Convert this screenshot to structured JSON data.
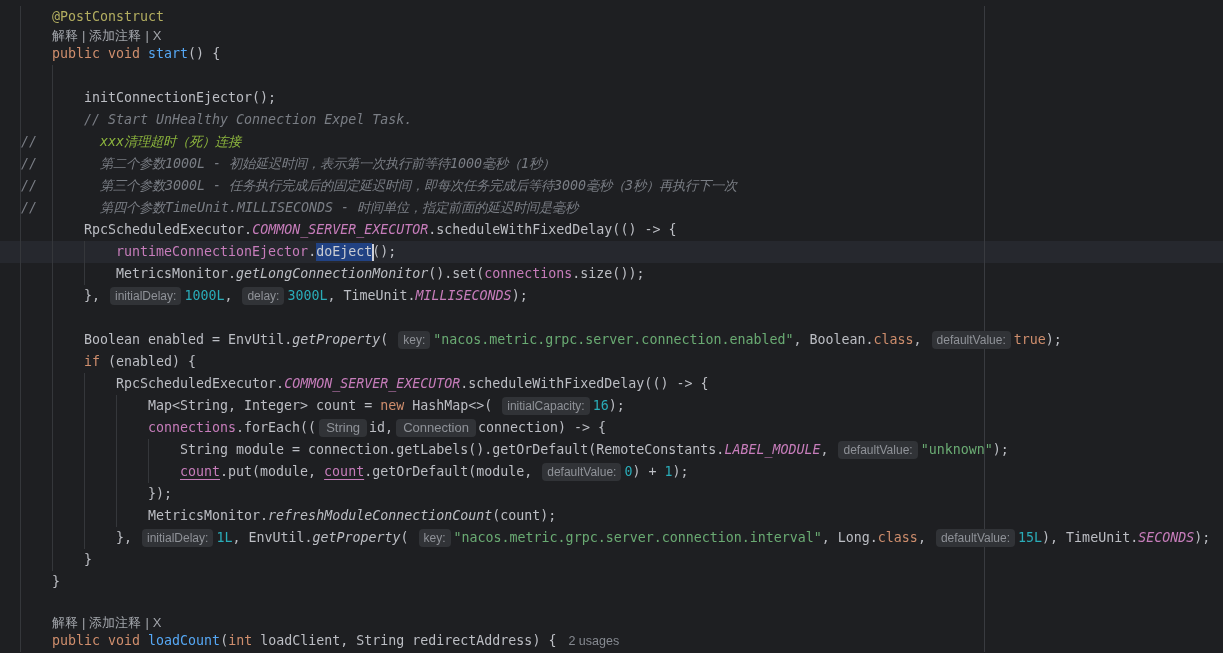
{
  "editor": {
    "lines": [
      {
        "kind": "code",
        "current": false,
        "segments": [
          {
            "kind": "code",
            "runs": [
              {
                "kind": "annotation",
                "text": "@PostConstruct"
              }
            ]
          }
        ]
      },
      {
        "kind": "code_vision",
        "current": false,
        "items": [
          {
            "kind": "action",
            "text": "解释"
          },
          {
            "kind": "separator",
            "text": "|"
          },
          {
            "kind": "action",
            "text": "添加注释"
          },
          {
            "kind": "separator",
            "text": "|"
          },
          {
            "kind": "action",
            "text": "X"
          }
        ]
      },
      {
        "kind": "code",
        "current": false,
        "segments": [
          {
            "kind": "code",
            "runs": [
              {
                "kind": "keyword",
                "text": "public void "
              },
              {
                "kind": "method_decl",
                "text": "start"
              },
              {
                "kind": "plain",
                "text": "() {"
              }
            ]
          }
        ],
        "children": [
          {
            "kind": "blank",
            "current": false
          },
          {
            "kind": "code",
            "current": false,
            "segments": [
              {
                "kind": "code",
                "runs": [
                  {
                    "kind": "plain",
                    "text": "initConnectionEjector();"
                  }
                ]
              }
            ]
          },
          {
            "kind": "code",
            "current": false,
            "segments": [
              {
                "kind": "code",
                "runs": [
                  {
                    "kind": "comment",
                    "text": "// Start UnHealthy Connection Expel Task."
                  }
                ]
              }
            ]
          },
          {
            "kind": "commented",
            "current": false,
            "marker": "//",
            "segments": [
              {
                "kind": "code",
                "runs": [
                  {
                    "kind": "todo",
                    "text": "xxx清理超时（死）连接"
                  }
                ]
              }
            ]
          },
          {
            "kind": "commented",
            "current": false,
            "marker": "//",
            "segments": [
              {
                "kind": "code",
                "runs": [
                  {
                    "kind": "comment",
                    "text": "第二个参数1000L - 初始延迟时间，表示第一次执行前等待1000毫秒（1秒）"
                  }
                ]
              }
            ]
          },
          {
            "kind": "commented",
            "current": false,
            "marker": "//",
            "segments": [
              {
                "kind": "code",
                "runs": [
                  {
                    "kind": "comment",
                    "text": "第三个参数3000L - 任务执行完成后的固定延迟时间，即每次任务完成后等待3000毫秒（3秒）再执行下一次"
                  }
                ]
              }
            ]
          },
          {
            "kind": "commented",
            "current": false,
            "marker": "//",
            "segments": [
              {
                "kind": "code",
                "runs": [
                  {
                    "kind": "comment",
                    "text": "第四个参数TimeUnit.MILLISECONDS - 时间单位，指定前面的延迟时间是毫秒"
                  }
                ]
              }
            ]
          },
          {
            "kind": "code",
            "current": false,
            "segments": [
              {
                "kind": "code",
                "runs": [
                  {
                    "kind": "plain",
                    "text": "RpcScheduledExecutor."
                  },
                  {
                    "kind": "static_field",
                    "text": "COMMON_SERVER_EXECUTOR"
                  },
                  {
                    "kind": "plain",
                    "text": ".scheduleWithFixedDelay(() -> {"
                  }
                ]
              }
            ],
            "children": [
              {
                "kind": "code",
                "current": true,
                "segments": [
                  {
                    "kind": "code",
                    "runs": [
                      {
                        "kind": "field",
                        "text": "runtimeConnectionEjector"
                      },
                      {
                        "kind": "plain",
                        "text": "."
                      }
                    ]
                  },
                  {
                    "kind": "selection",
                    "text": "doEject",
                    "caret": true
                  },
                  {
                    "kind": "code",
                    "runs": [
                      {
                        "kind": "plain",
                        "text": "();"
                      }
                    ]
                  }
                ]
              },
              {
                "kind": "code",
                "current": false,
                "segments": [
                  {
                    "kind": "code",
                    "runs": [
                      {
                        "kind": "plain",
                        "text": "MetricsMonitor."
                      },
                      {
                        "kind": "static_call",
                        "text": "getLongConnectionMonitor"
                      },
                      {
                        "kind": "plain",
                        "text": "().set("
                      },
                      {
                        "kind": "field",
                        "text": "connections"
                      },
                      {
                        "kind": "plain",
                        "text": ".size());"
                      }
                    ]
                  }
                ]
              }
            ]
          },
          {
            "kind": "code",
            "current": false,
            "segments": [
              {
                "kind": "code",
                "runs": [
                  {
                    "kind": "plain",
                    "text": "},"
                  }
                ]
              },
              {
                "kind": "param_hint",
                "text": "initialDelay:"
              },
              {
                "kind": "code",
                "runs": [
                  {
                    "kind": "number",
                    "text": "1000L"
                  },
                  {
                    "kind": "plain",
                    "text": ","
                  }
                ]
              },
              {
                "kind": "param_hint",
                "text": "delay:"
              },
              {
                "kind": "code",
                "runs": [
                  {
                    "kind": "number",
                    "text": "3000L"
                  },
                  {
                    "kind": "plain",
                    "text": ", TimeUnit."
                  },
                  {
                    "kind": "static_field",
                    "text": "MILLISECONDS"
                  },
                  {
                    "kind": "plain",
                    "text": ");"
                  }
                ]
              }
            ]
          },
          {
            "kind": "blank",
            "current": false
          },
          {
            "kind": "code",
            "current": false,
            "segments": [
              {
                "kind": "code",
                "runs": [
                  {
                    "kind": "plain",
                    "text": "Boolean enabled = EnvUtil."
                  },
                  {
                    "kind": "static_call",
                    "text": "getProperty"
                  },
                  {
                    "kind": "plain",
                    "text": "("
                  }
                ]
              },
              {
                "kind": "param_hint",
                "text": "key:"
              },
              {
                "kind": "code",
                "runs": [
                  {
                    "kind": "string",
                    "text": "\"nacos.metric.grpc.server.connection.enabled\""
                  },
                  {
                    "kind": "plain",
                    "text": ", Boolean."
                  },
                  {
                    "kind": "keyword",
                    "text": "class"
                  },
                  {
                    "kind": "plain",
                    "text": ","
                  }
                ]
              },
              {
                "kind": "param_hint",
                "text": "defaultValue:"
              },
              {
                "kind": "code",
                "runs": [
                  {
                    "kind": "keyword",
                    "text": "true"
                  },
                  {
                    "kind": "plain",
                    "text": ");"
                  }
                ]
              }
            ]
          },
          {
            "kind": "code",
            "current": false,
            "segments": [
              {
                "kind": "code",
                "runs": [
                  {
                    "kind": "keyword",
                    "text": "if"
                  },
                  {
                    "kind": "plain",
                    "text": " (enabled) {"
                  }
                ]
              }
            ],
            "children": [
              {
                "kind": "code",
                "current": false,
                "segments": [
                  {
                    "kind": "code",
                    "runs": [
                      {
                        "kind": "plain",
                        "text": "RpcScheduledExecutor."
                      },
                      {
                        "kind": "static_field",
                        "text": "COMMON_SERVER_EXECUTOR"
                      },
                      {
                        "kind": "plain",
                        "text": ".scheduleWithFixedDelay(() -> {"
                      }
                    ]
                  }
                ],
                "children": [
                  {
                    "kind": "code",
                    "current": false,
                    "segments": [
                      {
                        "kind": "code",
                        "runs": [
                          {
                            "kind": "plain",
                            "text": "Map<String, Integer> count = "
                          },
                          {
                            "kind": "keyword",
                            "text": "new"
                          },
                          {
                            "kind": "plain",
                            "text": " HashMap<>("
                          }
                        ]
                      },
                      {
                        "kind": "param_hint",
                        "text": "initialCapacity:"
                      },
                      {
                        "kind": "code",
                        "runs": [
                          {
                            "kind": "number",
                            "text": "16"
                          },
                          {
                            "kind": "plain",
                            "text": ");"
                          }
                        ]
                      }
                    ]
                  },
                  {
                    "kind": "code",
                    "current": false,
                    "segments": [
                      {
                        "kind": "code",
                        "runs": [
                          {
                            "kind": "field",
                            "text": "connections"
                          },
                          {
                            "kind": "plain",
                            "text": ".forEach(("
                          }
                        ]
                      },
                      {
                        "kind": "type_hint",
                        "text": "String"
                      },
                      {
                        "kind": "code",
                        "runs": [
                          {
                            "kind": "plain",
                            "text": "id,"
                          }
                        ]
                      },
                      {
                        "kind": "type_hint",
                        "text": "Connection"
                      },
                      {
                        "kind": "code",
                        "runs": [
                          {
                            "kind": "plain",
                            "text": "connection) -> {"
                          }
                        ]
                      }
                    ],
                    "children": [
                      {
                        "kind": "code",
                        "current": false,
                        "segments": [
                          {
                            "kind": "code",
                            "runs": [
                              {
                                "kind": "plain",
                                "text": "String module = connection.getLabels().getOrDefault(RemoteConstants."
                              },
                              {
                                "kind": "static_field",
                                "text": "LABEL_MODULE"
                              },
                              {
                                "kind": "plain",
                                "text": ","
                              }
                            ]
                          },
                          {
                            "kind": "param_hint",
                            "text": "defaultValue:"
                          },
                          {
                            "kind": "code",
                            "runs": [
                              {
                                "kind": "string",
                                "text": "\"unknown\""
                              },
                              {
                                "kind": "plain",
                                "text": ");"
                              }
                            ]
                          }
                        ]
                      },
                      {
                        "kind": "code",
                        "current": false,
                        "segments": [
                          {
                            "kind": "code",
                            "runs": [
                              {
                                "kind": "captured",
                                "text": "count"
                              },
                              {
                                "kind": "plain",
                                "text": ".put(module, "
                              },
                              {
                                "kind": "captured",
                                "text": "count"
                              },
                              {
                                "kind": "plain",
                                "text": ".getOrDefault(module,"
                              }
                            ]
                          },
                          {
                            "kind": "param_hint",
                            "text": "defaultValue:"
                          },
                          {
                            "kind": "code",
                            "runs": [
                              {
                                "kind": "number",
                                "text": "0"
                              },
                              {
                                "kind": "plain",
                                "text": ") + "
                              },
                              {
                                "kind": "number",
                                "text": "1"
                              },
                              {
                                "kind": "plain",
                                "text": ");"
                              }
                            ]
                          }
                        ]
                      }
                    ]
                  },
                  {
                    "kind": "code",
                    "current": false,
                    "segments": [
                      {
                        "kind": "code",
                        "runs": [
                          {
                            "kind": "plain",
                            "text": "});"
                          }
                        ]
                      }
                    ]
                  },
                  {
                    "kind": "code",
                    "current": false,
                    "segments": [
                      {
                        "kind": "code",
                        "runs": [
                          {
                            "kind": "plain",
                            "text": "MetricsMonitor."
                          },
                          {
                            "kind": "static_call",
                            "text": "refreshModuleConnectionCount"
                          },
                          {
                            "kind": "plain",
                            "text": "(count);"
                          }
                        ]
                      }
                    ]
                  }
                ]
              },
              {
                "kind": "code",
                "current": false,
                "segments": [
                  {
                    "kind": "code",
                    "runs": [
                      {
                        "kind": "plain",
                        "text": "},"
                      }
                    ]
                  },
                  {
                    "kind": "param_hint",
                    "text": "initialDelay:"
                  },
                  {
                    "kind": "code",
                    "runs": [
                      {
                        "kind": "number",
                        "text": "1L"
                      },
                      {
                        "kind": "plain",
                        "text": ", EnvUtil."
                      },
                      {
                        "kind": "static_call",
                        "text": "getProperty"
                      },
                      {
                        "kind": "plain",
                        "text": "("
                      }
                    ]
                  },
                  {
                    "kind": "param_hint",
                    "text": "key:"
                  },
                  {
                    "kind": "code",
                    "runs": [
                      {
                        "kind": "string",
                        "text": "\"nacos.metric.grpc.server.connection.interval\""
                      },
                      {
                        "kind": "plain",
                        "text": ", Long."
                      },
                      {
                        "kind": "keyword",
                        "text": "class"
                      },
                      {
                        "kind": "plain",
                        "text": ","
                      }
                    ]
                  },
                  {
                    "kind": "param_hint",
                    "text": "defaultValue:"
                  },
                  {
                    "kind": "code",
                    "runs": [
                      {
                        "kind": "number",
                        "text": "15L"
                      },
                      {
                        "kind": "plain",
                        "text": "), TimeUnit."
                      },
                      {
                        "kind": "static_field",
                        "text": "SECONDS"
                      },
                      {
                        "kind": "plain",
                        "text": ");"
                      }
                    ]
                  }
                ]
              }
            ]
          },
          {
            "kind": "code",
            "current": false,
            "segments": [
              {
                "kind": "code",
                "runs": [
                  {
                    "kind": "plain",
                    "text": "}"
                  }
                ]
              }
            ]
          }
        ]
      },
      {
        "kind": "code",
        "current": false,
        "segments": [
          {
            "kind": "code",
            "runs": [
              {
                "kind": "plain",
                "text": "}"
              }
            ]
          }
        ]
      },
      {
        "kind": "blank",
        "current": false
      },
      {
        "kind": "code_vision",
        "current": false,
        "items": [
          {
            "kind": "action",
            "text": "解释"
          },
          {
            "kind": "separator",
            "text": "|"
          },
          {
            "kind": "action",
            "text": "添加注释"
          },
          {
            "kind": "separator",
            "text": "|"
          },
          {
            "kind": "action",
            "text": "X"
          }
        ]
      },
      {
        "kind": "code",
        "current": false,
        "segments": [
          {
            "kind": "code",
            "runs": [
              {
                "kind": "keyword",
                "text": "public void "
              },
              {
                "kind": "method_decl",
                "text": "loadCount"
              },
              {
                "kind": "plain",
                "text": "("
              },
              {
                "kind": "keyword",
                "text": "int"
              },
              {
                "kind": "plain",
                "text": " loadClient, String redirectAddress) {"
              }
            ]
          },
          {
            "kind": "usages",
            "text": "2 usages"
          }
        ]
      }
    ]
  }
}
